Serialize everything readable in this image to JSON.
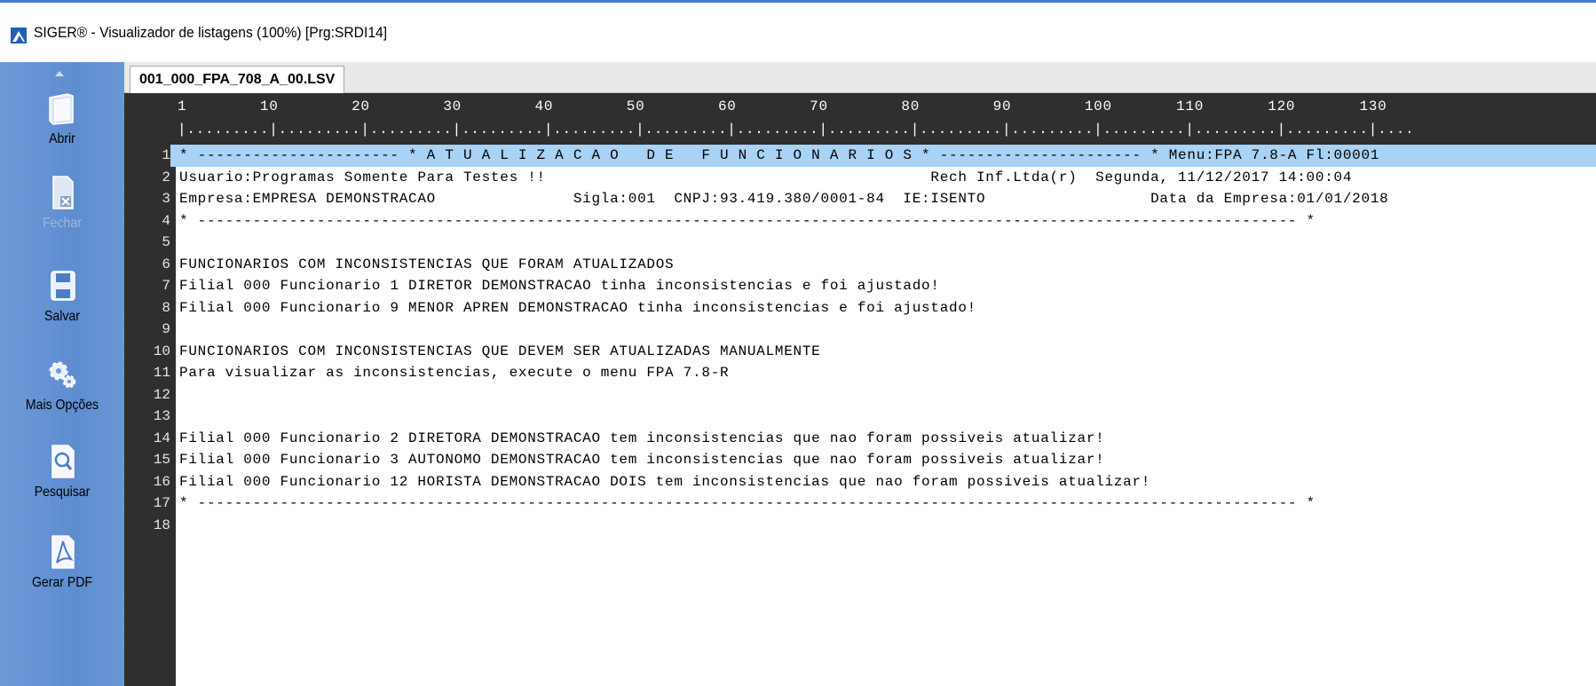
{
  "window": {
    "title": "SIGER® - Visualizador de listagens (100%) [Prg:SRDI14]"
  },
  "sidebar": {
    "items": [
      {
        "label": "Abrir",
        "icon": "folder-icon",
        "enabled": true
      },
      {
        "label": "Fechar",
        "icon": "close-file-icon",
        "enabled": false
      },
      {
        "label": "Salvar",
        "icon": "floppy-disk-icon",
        "enabled": true
      },
      {
        "label": "Mais Opções",
        "icon": "gears-icon",
        "enabled": true
      },
      {
        "label": "Pesquisar",
        "icon": "search-document-icon",
        "enabled": true
      },
      {
        "label": "Gerar PDF",
        "icon": "pdf-icon",
        "enabled": true
      }
    ]
  },
  "tabs": [
    {
      "label": "001_000_FPA_708_A_00.LSV",
      "active": true
    }
  ],
  "ruler": {
    "numbers": "1        10        20        30        40        50        60        70        80        90        100       110       120       130",
    "ticks": "|.........|.........|.........|.........|.........|.........|.........|.........|.........|.........|.........|.........|.........|...."
  },
  "lines": [
    {
      "n": "1",
      "text": "* ---------------------- * A T U A L I Z A C A O   D E   F U N C I O N A R I O S * ---------------------- * Menu:FPA 7.8-A Fl:00001",
      "highlight": true
    },
    {
      "n": "2",
      "text": "Usuario:Programas Somente Para Testes !!                                          Rech Inf.Ltda(r)  Segunda, 11/12/2017 14:00:04"
    },
    {
      "n": "3",
      "text": "Empresa:EMPRESA DEMONSTRACAO               Sigla:001  CNPJ:93.419.380/0001-84  IE:ISENTO                  Data da Empresa:01/01/2018"
    },
    {
      "n": "4",
      "text": "* ------------------------------------------------------------------------------------------------------------------------ *"
    },
    {
      "n": "5",
      "text": ""
    },
    {
      "n": "6",
      "text": "FUNCIONARIOS COM INCONSISTENCIAS QUE FORAM ATUALIZADOS"
    },
    {
      "n": "7",
      "text": "Filial 000 Funcionario 1 DIRETOR DEMONSTRACAO tinha inconsistencias e foi ajustado!"
    },
    {
      "n": "8",
      "text": "Filial 000 Funcionario 9 MENOR APREN DEMONSTRACAO tinha inconsistencias e foi ajustado!"
    },
    {
      "n": "9",
      "text": ""
    },
    {
      "n": "10",
      "text": "FUNCIONARIOS COM INCONSISTENCIAS QUE DEVEM SER ATUALIZADAS MANUALMENTE"
    },
    {
      "n": "11",
      "text": "Para visualizar as inconsistencias, execute o menu FPA 7.8-R"
    },
    {
      "n": "12",
      "text": ""
    },
    {
      "n": "13",
      "text": ""
    },
    {
      "n": "14",
      "text": "Filial 000 Funcionario 2 DIRETORA DEMONSTRACAO tem inconsistencias que nao foram possiveis atualizar!"
    },
    {
      "n": "15",
      "text": "Filial 000 Funcionario 3 AUTONOMO DEMONSTRACAO tem inconsistencias que nao foram possiveis atualizar!"
    },
    {
      "n": "16",
      "text": "Filial 000 Funcionario 12 HORISTA DEMONSTRACAO DOIS tem inconsistencias que nao foram possiveis atualizar!"
    },
    {
      "n": "17",
      "text": "* ------------------------------------------------------------------------------------------------------------------------ *"
    },
    {
      "n": "18",
      "text": ""
    }
  ],
  "colors": {
    "sidebar": "#5e8dd0",
    "highlight": "#a9d2f4",
    "gutter": "#2f2f2f",
    "titlebar_accent": "#3a7bd5"
  }
}
